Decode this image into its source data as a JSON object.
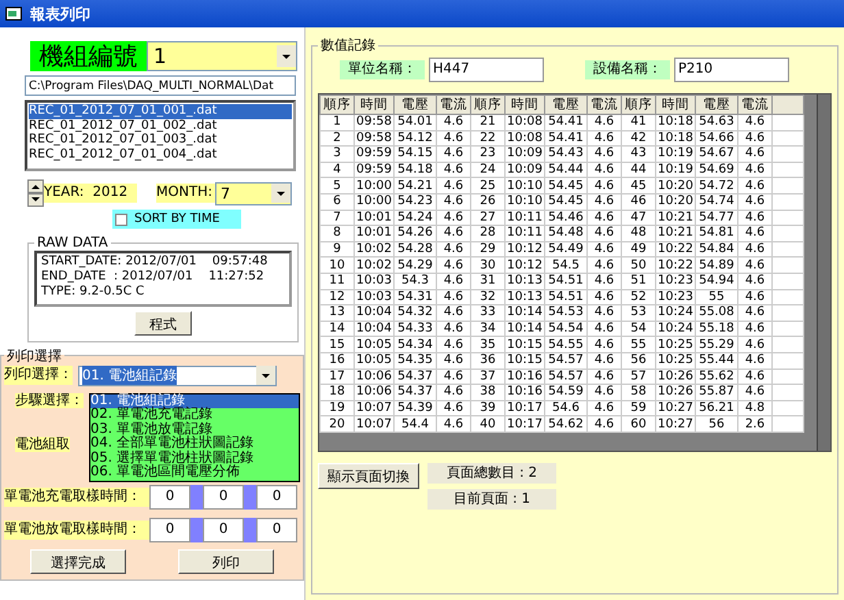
{
  "window": {
    "title": "報表列印"
  },
  "unit_selector": {
    "label": "機組編號",
    "value": "1"
  },
  "path": {
    "value": "C:\\Program Files\\DAQ_MULTI_NORMAL\\Dat"
  },
  "files": [
    {
      "name": "REC_01_2012_07_01_001_.dat",
      "selected": true
    },
    {
      "name": "REC_01_2012_07_01_002_.dat",
      "selected": false
    },
    {
      "name": "REC_01_2012_07_01_003_.dat",
      "selected": false
    },
    {
      "name": "REC_01_2012_07_01_004_.dat",
      "selected": false
    }
  ],
  "year": {
    "label": "YEAR:",
    "value": "2012"
  },
  "month": {
    "label": "MONTH:",
    "value": "7"
  },
  "sort_by_time": {
    "label": "SORT BY TIME",
    "checked": false
  },
  "raw_data": {
    "title": "RAW DATA",
    "lines": [
      "START_DATE: 2012/07/01    09:57:48",
      "END_DATE  : 2012/07/01    11:27:52",
      "TYPE: 9.2-0.5C C"
    ],
    "button": "程式"
  },
  "print_selection": {
    "title": "列印選擇",
    "print_label": "列印選擇：",
    "print_value": "01. 電池組記錄",
    "step_label": "步驟選擇：",
    "group_label": "電池組取",
    "options": [
      {
        "label": "01. 電池組記錄",
        "selected": true
      },
      {
        "label": "02. 單電池充電記錄",
        "selected": false
      },
      {
        "label": "03. 單電池放電記錄",
        "selected": false
      },
      {
        "label": "04. 全部單電池柱狀圖記錄",
        "selected": false
      },
      {
        "label": "05. 選擇單電池柱狀圖記錄",
        "selected": false
      },
      {
        "label": "06. 單電池區間電壓分佈",
        "selected": false
      }
    ],
    "times": [
      {
        "label": "單電池充電取樣時間：",
        "values": [
          "0",
          "0",
          "0"
        ]
      },
      {
        "label": "單電池放電取樣時間：",
        "values": [
          "0",
          "0",
          "0"
        ]
      }
    ],
    "buttons": [
      "選擇完成",
      "列印"
    ]
  },
  "records": {
    "title": "數值記錄",
    "unit_name": {
      "label": "單位名稱：",
      "value": "H447"
    },
    "device_name": {
      "label": "設備名稱：",
      "value": "P210"
    },
    "columns": [
      "順序",
      "時間",
      "電壓",
      "電流",
      "順序",
      "時間",
      "電壓",
      "電流",
      "順序",
      "時間",
      "電壓",
      "電流"
    ],
    "rows": [
      [
        "1",
        "09:58",
        "54.01",
        "4.6",
        "21",
        "10:08",
        "54.41",
        "4.6",
        "41",
        "10:18",
        "54.63",
        "4.6"
      ],
      [
        "2",
        "09:58",
        "54.12",
        "4.6",
        "22",
        "10:08",
        "54.41",
        "4.6",
        "42",
        "10:18",
        "54.66",
        "4.6"
      ],
      [
        "3",
        "09:59",
        "54.15",
        "4.6",
        "23",
        "10:09",
        "54.43",
        "4.6",
        "43",
        "10:19",
        "54.67",
        "4.6"
      ],
      [
        "4",
        "09:59",
        "54.18",
        "4.6",
        "24",
        "10:09",
        "54.44",
        "4.6",
        "44",
        "10:19",
        "54.69",
        "4.6"
      ],
      [
        "5",
        "10:00",
        "54.21",
        "4.6",
        "25",
        "10:10",
        "54.45",
        "4.6",
        "45",
        "10:20",
        "54.72",
        "4.6"
      ],
      [
        "6",
        "10:00",
        "54.23",
        "4.6",
        "26",
        "10:10",
        "54.45",
        "4.6",
        "46",
        "10:20",
        "54.74",
        "4.6"
      ],
      [
        "7",
        "10:01",
        "54.24",
        "4.6",
        "27",
        "10:11",
        "54.46",
        "4.6",
        "47",
        "10:21",
        "54.77",
        "4.6"
      ],
      [
        "8",
        "10:01",
        "54.26",
        "4.6",
        "28",
        "10:11",
        "54.48",
        "4.6",
        "48",
        "10:21",
        "54.81",
        "4.6"
      ],
      [
        "9",
        "10:02",
        "54.28",
        "4.6",
        "29",
        "10:12",
        "54.49",
        "4.6",
        "49",
        "10:22",
        "54.84",
        "4.6"
      ],
      [
        "10",
        "10:02",
        "54.29",
        "4.6",
        "30",
        "10:12",
        "54.5",
        "4.6",
        "50",
        "10:22",
        "54.89",
        "4.6"
      ],
      [
        "11",
        "10:03",
        "54.3",
        "4.6",
        "31",
        "10:13",
        "54.51",
        "4.6",
        "51",
        "10:23",
        "54.94",
        "4.6"
      ],
      [
        "12",
        "10:03",
        "54.31",
        "4.6",
        "32",
        "10:13",
        "54.51",
        "4.6",
        "52",
        "10:23",
        "55",
        "4.6"
      ],
      [
        "13",
        "10:04",
        "54.32",
        "4.6",
        "33",
        "10:14",
        "54.53",
        "4.6",
        "53",
        "10:24",
        "55.08",
        "4.6"
      ],
      [
        "14",
        "10:04",
        "54.33",
        "4.6",
        "34",
        "10:14",
        "54.54",
        "4.6",
        "54",
        "10:24",
        "55.18",
        "4.6"
      ],
      [
        "15",
        "10:05",
        "54.34",
        "4.6",
        "35",
        "10:15",
        "54.55",
        "4.6",
        "55",
        "10:25",
        "55.29",
        "4.6"
      ],
      [
        "16",
        "10:05",
        "54.35",
        "4.6",
        "36",
        "10:15",
        "54.57",
        "4.6",
        "56",
        "10:25",
        "55.44",
        "4.6"
      ],
      [
        "17",
        "10:06",
        "54.37",
        "4.6",
        "37",
        "10:16",
        "54.57",
        "4.6",
        "57",
        "10:26",
        "55.62",
        "4.6"
      ],
      [
        "18",
        "10:06",
        "54.37",
        "4.6",
        "38",
        "10:16",
        "54.59",
        "4.6",
        "58",
        "10:26",
        "55.87",
        "4.6"
      ],
      [
        "19",
        "10:07",
        "54.39",
        "4.6",
        "39",
        "10:17",
        "54.6",
        "4.6",
        "59",
        "10:27",
        "56.21",
        "4.8"
      ],
      [
        "20",
        "10:07",
        "54.4",
        "4.6",
        "40",
        "10:17",
        "54.62",
        "4.6",
        "60",
        "10:27",
        "56",
        "2.6"
      ]
    ],
    "switch_button": "顯示頁面切換",
    "total_pages": "頁面總數目 : 2",
    "current_page": "目前頁面 : 1"
  }
}
